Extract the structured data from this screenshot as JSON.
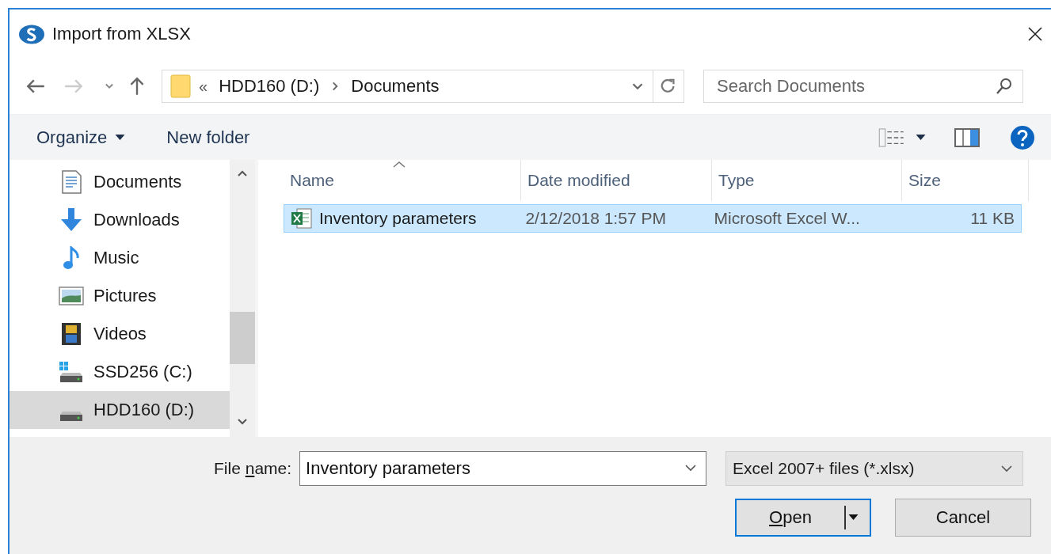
{
  "window": {
    "title": "Import from XLSX"
  },
  "address": {
    "overflow": "«",
    "crumbs": [
      "HDD160 (D:)",
      "Documents"
    ]
  },
  "search": {
    "placeholder": "Search Documents"
  },
  "toolbar": {
    "organize": "Organize",
    "new_folder": "New folder"
  },
  "sidebar": {
    "items": [
      {
        "label": "Documents",
        "kind": "documents",
        "selected": false
      },
      {
        "label": "Downloads",
        "kind": "downloads",
        "selected": false
      },
      {
        "label": "Music",
        "kind": "music",
        "selected": false
      },
      {
        "label": "Pictures",
        "kind": "pictures",
        "selected": false
      },
      {
        "label": "Videos",
        "kind": "videos",
        "selected": false
      },
      {
        "label": "SSD256 (C:)",
        "kind": "system-drive",
        "selected": false
      },
      {
        "label": "HDD160 (D:)",
        "kind": "drive",
        "selected": true
      }
    ]
  },
  "table": {
    "columns": [
      "Name",
      "Date modified",
      "Type",
      "Size"
    ],
    "rows": [
      {
        "name": "Inventory parameters",
        "date": "2/12/2018 1:57 PM",
        "type": "Microsoft Excel W...",
        "size": "11 KB",
        "selected": true
      }
    ]
  },
  "file_name": {
    "label": {
      "pre": "File ",
      "key": "n",
      "post": "ame:"
    },
    "value": "Inventory parameters"
  },
  "file_type": {
    "value": "Excel 2007+ files (*.xlsx)"
  },
  "buttons": {
    "open": {
      "key": "O",
      "post": "pen"
    },
    "cancel": "Cancel"
  }
}
